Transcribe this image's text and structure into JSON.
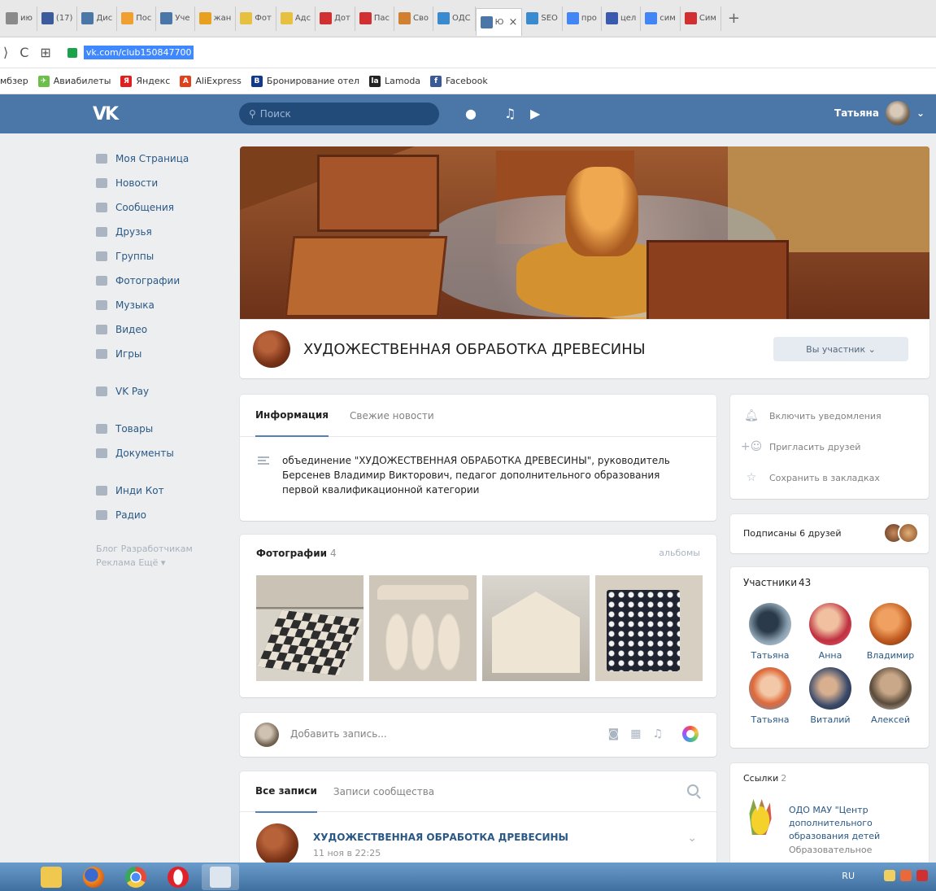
{
  "browser": {
    "tabs": [
      {
        "label": "ию",
        "color": "#8a8a8a"
      },
      {
        "label": "(17)",
        "color": "#3b5b9d"
      },
      {
        "label": "Дис",
        "color": "#4a76a8"
      },
      {
        "label": "Пос",
        "color": "#f0a030"
      },
      {
        "label": "Уче",
        "color": "#4a76a8"
      },
      {
        "label": "жан",
        "color": "#e8a020"
      },
      {
        "label": "Фот",
        "color": "#e8c040"
      },
      {
        "label": "Адс",
        "color": "#e8c040"
      },
      {
        "label": "Дот",
        "color": "#d03030"
      },
      {
        "label": "Пас",
        "color": "#d03030"
      },
      {
        "label": "Сво",
        "color": "#d08030"
      },
      {
        "label": "ОДС",
        "color": "#3a8ad0"
      },
      {
        "label": "Ю",
        "color": "#4a76a8",
        "active": true
      },
      {
        "label": "SEO",
        "color": "#3a8ad0"
      },
      {
        "label": "про",
        "color": "#4285f4"
      },
      {
        "label": "цел",
        "color": "#3a5ab0"
      },
      {
        "label": "сим",
        "color": "#4285f4"
      },
      {
        "label": "Сим",
        "color": "#d03030"
      }
    ],
    "new_tab": "+",
    "close_glyph": "×",
    "url": "vk.com/club150847700",
    "bookmarks": [
      {
        "label": "мбзер",
        "color": "#ffffff",
        "glyph": ""
      },
      {
        "label": "Авиабилеты",
        "color": "#6cc04a",
        "glyph": "✈"
      },
      {
        "label": "Яндекс",
        "color": "#e02020",
        "glyph": "Я"
      },
      {
        "label": "AliExpress",
        "color": "#e0401a",
        "glyph": "A"
      },
      {
        "label": "Бронирование отел",
        "color": "#123a8a",
        "glyph": "B"
      },
      {
        "label": "Lamoda",
        "color": "#222222",
        "glyph": "la"
      },
      {
        "label": "Facebook",
        "color": "#3b5998",
        "glyph": "f"
      }
    ]
  },
  "header": {
    "logo": "VK",
    "search_placeholder": "Поиск",
    "user_name": "Татьяна"
  },
  "left_menu": {
    "items": [
      "Моя Страница",
      "Новости",
      "Сообщения",
      "Друзья",
      "Группы",
      "Фотографии",
      "Музыка",
      "Видео",
      "Игры"
    ],
    "items2": [
      "VK Pay"
    ],
    "items3": [
      "Товары",
      "Документы"
    ],
    "items4": [
      "Инди Кот",
      "Радио"
    ],
    "footer_line1": "Блог  Разработчикам",
    "footer_line2": "Реклама  Ещё ▾"
  },
  "group": {
    "title": "ХУДОЖЕСТВЕННАЯ ОБРАБОТКА ДРЕВЕСИНЫ",
    "member_button": "Вы участник ⌄"
  },
  "info": {
    "tab_info": "Информация",
    "tab_news": "Свежие новости",
    "text": "объединение \"ХУДОЖЕСТВЕННАЯ ОБРАБОТКА ДРЕВЕСИНЫ\", руководитель Берсенев Владимир Викторович, педагог дополнительного образования первой квалификационной категории"
  },
  "photos": {
    "title": "Фотографии",
    "count": "4",
    "albums": "альбомы"
  },
  "post_box": {
    "placeholder": "Добавить запись...",
    "icon_camera": "◙",
    "icon_video": "▦",
    "icon_music": "♫"
  },
  "wall": {
    "tab_all": "Все записи",
    "tab_community": "Записи сообщества",
    "author": "ХУДОЖЕСТВЕННАЯ ОБРАБОТКА ДРЕВЕСИНЫ",
    "date": "11 ноя в 22:25",
    "more": "⌄"
  },
  "actions": {
    "notify": "Включить уведомления",
    "invite": "Пригласить друзей",
    "bookmark": "Сохранить в закладках"
  },
  "friends": {
    "text": "Подписаны 6 друзей"
  },
  "members": {
    "title": "Участники",
    "count": "43",
    "list": [
      "Татьяна",
      "Анна",
      "Владимир",
      "Татьяна",
      "Виталий",
      "Алексей"
    ]
  },
  "links": {
    "title": "Ссылки",
    "count": "2",
    "text": "ОДО МАУ \"Центр дополнительного образования детей",
    "subtitle": "Образовательное"
  },
  "taskbar": {
    "lang": "RU"
  }
}
